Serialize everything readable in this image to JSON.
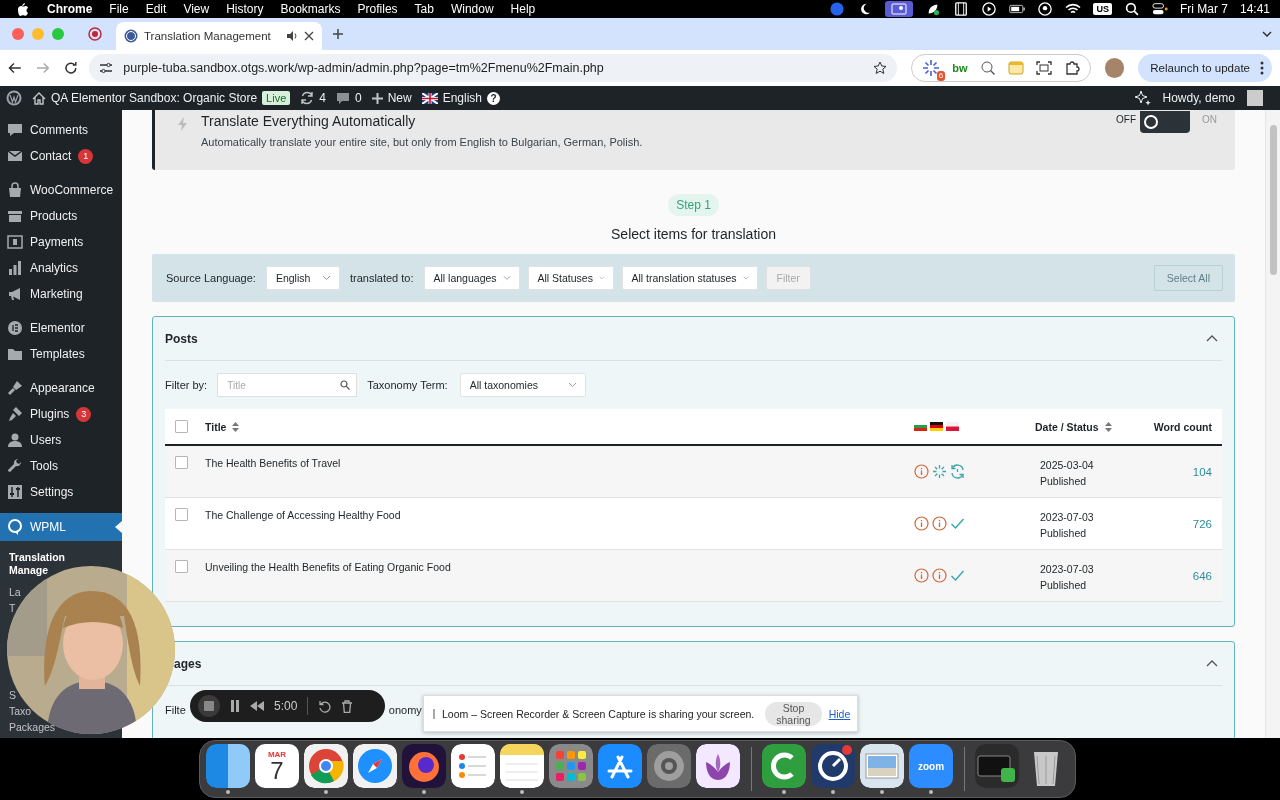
{
  "menu_bar": {
    "app": "Chrome",
    "menus": [
      "File",
      "Edit",
      "View",
      "History",
      "Bookmarks",
      "Profiles",
      "Tab",
      "Window",
      "Help"
    ],
    "input_source": "US",
    "date": "Fri Mar 7",
    "time": "14:41"
  },
  "browser": {
    "tab": {
      "title": "Translation Management",
      "selected": true
    },
    "url": "purple-tuba.sandbox.otgs.work/wp-admin/admin.php?page=tm%2Fmenu%2Fmain.php",
    "extension_badge": "6",
    "extension_text": "bw",
    "relaunch": "Relaunch to update"
  },
  "admin_bar": {
    "site": "QA Elementor Sandbox: Organic Store",
    "site_badge": "Live",
    "updates": "4",
    "comments": "0",
    "new": "New",
    "language": "English",
    "help": "?",
    "greeting": "Howdy, demo"
  },
  "sidebar": {
    "groups": [
      {
        "items": [
          {
            "label": "Comments",
            "kind": "comment",
            "selected": false
          },
          {
            "label": "Contact",
            "kind": "mail",
            "badge": "1",
            "selected": false
          }
        ]
      },
      {
        "items": [
          {
            "label": "WooCommerce",
            "kind": "bag",
            "selected": false
          },
          {
            "label": "Products",
            "kind": "box",
            "selected": false
          },
          {
            "label": "Payments",
            "kind": "money",
            "selected": false
          },
          {
            "label": "Analytics",
            "kind": "bars",
            "selected": false
          },
          {
            "label": "Marketing",
            "kind": "megaphone",
            "selected": false
          }
        ]
      },
      {
        "items": [
          {
            "label": "Elementor",
            "kind": "disc",
            "selected": false
          },
          {
            "label": "Templates",
            "kind": "folder",
            "selected": false
          }
        ]
      },
      {
        "items": [
          {
            "label": "Appearance",
            "kind": "brush",
            "selected": false
          },
          {
            "label": "Plugins",
            "kind": "plug",
            "badge": "3",
            "selected": false
          },
          {
            "label": "Users",
            "kind": "user",
            "selected": false
          },
          {
            "label": "Tools",
            "kind": "wrench",
            "selected": false
          },
          {
            "label": "Settings",
            "kind": "sliders",
            "selected": false
          }
        ]
      },
      {
        "items": [
          {
            "label": "WPML",
            "kind": "bubble",
            "selected": true
          }
        ]
      }
    ],
    "submenu": {
      "groups": [
        {
          "items": [
            {
              "label": "Translation Manage",
              "selected": true
            },
            {
              "label": "La",
              "selected": false
            },
            {
              "label": "T",
              "selected": false
            }
          ]
        },
        {
          "items": [
            {
              "label": "S",
              "selected": false
            },
            {
              "label": "Taxo",
              "selected": false
            },
            {
              "label": "Packages",
              "selected": false
            }
          ]
        }
      ]
    }
  },
  "automatic": {
    "title": "Translate Everything Automatically",
    "description": "Automatically translate your entire site, but only from English to Bulgarian, German, Polish.",
    "off_label": "OFF",
    "on_label": "ON",
    "on": false
  },
  "step": {
    "badge": "Step 1",
    "title": "Select items for translation"
  },
  "filters": {
    "source_label": "Source Language:",
    "source": "English",
    "target_label": "translated to:",
    "selects": [
      "All languages",
      "All Statuses",
      "All translation statuses"
    ],
    "filter_button": {
      "label": "Filter",
      "disabled": true
    },
    "select_all": {
      "label": "Select All",
      "disabled": true
    }
  },
  "sections": [
    {
      "title": "Posts",
      "expanded": true,
      "filter_label": "Filter by:",
      "search_placeholder": "Title",
      "taxonomy_label": "Taxonomy Term:",
      "taxonomy": "All taxonomies",
      "table": {
        "all_selected": false,
        "columns": [
          "Title",
          "Date / Status",
          "Word count"
        ],
        "rows": [
          {
            "title": "The Health Benefits of Travel",
            "selected": false,
            "statuses": [
              {
                "kind": "info"
              },
              {
                "kind": "progress"
              },
              {
                "kind": "update"
              }
            ],
            "date": "2025-03-04",
            "status": "Published",
            "words": "104"
          },
          {
            "title": "The Challenge of Accessing Healthy Food",
            "selected": false,
            "statuses": [
              {
                "kind": "info"
              },
              {
                "kind": "info"
              },
              {
                "kind": "done"
              }
            ],
            "date": "2023-07-03",
            "status": "Published",
            "words": "726"
          },
          {
            "title": "Unveiling the Health Benefits of Eating Organic Food",
            "selected": false,
            "statuses": [
              {
                "kind": "info"
              },
              {
                "kind": "info"
              },
              {
                "kind": "done"
              }
            ],
            "date": "2023-07-03",
            "status": "Published",
            "words": "646"
          }
        ]
      }
    },
    {
      "title": "ages",
      "expanded": true,
      "filter_label": "Filte",
      "taxonomy_label": "onomy"
    }
  ],
  "recorder": {
    "time": "5:00"
  },
  "share_bar": {
    "message": "Loom – Screen Recorder & Screen Capture is sharing your screen.",
    "stop": "Stop sharing",
    "hide": "Hide"
  },
  "dock": {
    "apps": [
      {
        "kind": "finder",
        "running": true
      },
      {
        "kind": "calendar",
        "month": "MAR",
        "day": "7",
        "running": false
      },
      {
        "kind": "chrome",
        "running": true
      },
      {
        "kind": "safari",
        "running": false
      },
      {
        "kind": "firefox",
        "running": true
      },
      {
        "kind": "reminders",
        "running": false
      },
      {
        "kind": "notes",
        "running": true
      },
      {
        "kind": "launchpad",
        "running": false
      },
      {
        "kind": "appstore",
        "running": false
      },
      {
        "kind": "settings",
        "running": false
      },
      {
        "kind": "tulip",
        "running": false
      },
      {
        "kind": "camtasia",
        "separator_before": true,
        "running": true
      },
      {
        "kind": "dial",
        "running": true
      },
      {
        "kind": "preview",
        "running": true
      },
      {
        "kind": "zoom",
        "label": "zoom",
        "running": true
      },
      {
        "kind": "recorder",
        "separator_before": true,
        "running": false
      },
      {
        "kind": "trash",
        "running": false
      }
    ]
  }
}
